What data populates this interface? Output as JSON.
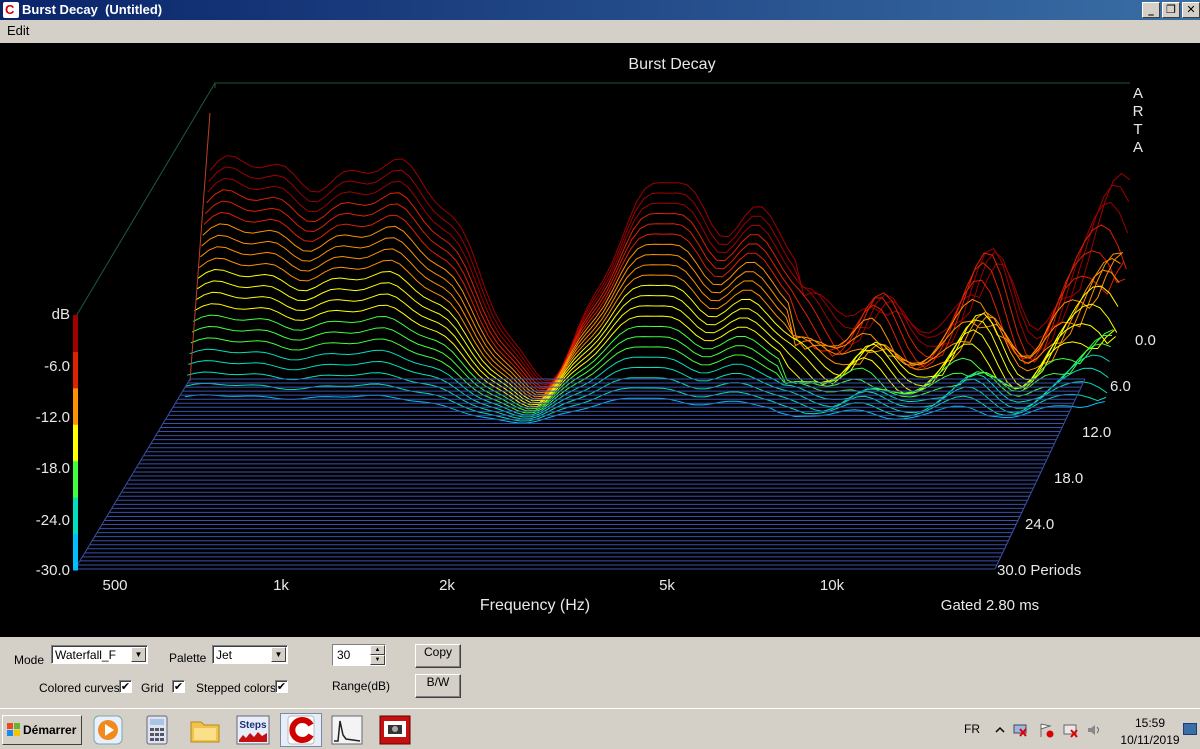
{
  "window": {
    "title": "Burst Decay  (Untitled)",
    "minimize_label": "_",
    "maximize_label": "❐",
    "close_label": "✕"
  },
  "menu": {
    "items": [
      "Edit"
    ]
  },
  "plot": {
    "title": "Burst Decay",
    "brand": [
      "A",
      "R",
      "T",
      "A"
    ],
    "xlabel": "Frequency (Hz)",
    "gated": "Gated 2.80 ms",
    "x_ticks": [
      "500",
      "1k",
      "2k",
      "5k",
      "10k"
    ],
    "db_unit": "dB",
    "db_ticks": [
      "-6.0",
      "-12.0",
      "-18.0",
      "-24.0",
      "-30.0"
    ],
    "period_ticks": [
      "0.0",
      "6.0",
      "12.0",
      "18.0",
      "24.0",
      "30.0 Periods"
    ],
    "palette_colors": [
      "#00bfff",
      "#00e0c0",
      "#40ff40",
      "#ffff00",
      "#ff9000",
      "#e02000",
      "#a00000"
    ]
  },
  "controls": {
    "mode_label": "Mode",
    "mode_value": "Waterfall_F",
    "palette_label": "Palette",
    "palette_value": "Jet",
    "range_value": "30",
    "range_label": "Range(dB)",
    "copy_label": "Copy",
    "bw_label": "B/W",
    "colored_curves_label": "Colored curves",
    "colored_curves_checked": true,
    "grid_label": "Grid",
    "grid_checked": true,
    "stepped_colors_label": "Stepped colors",
    "stepped_colors_checked": true,
    "check_glyph": "✔"
  },
  "taskbar": {
    "start_label": "Démarrer",
    "steps_label": "Steps",
    "lang": "FR",
    "time": "15:59",
    "date": "10/11/2019"
  }
}
